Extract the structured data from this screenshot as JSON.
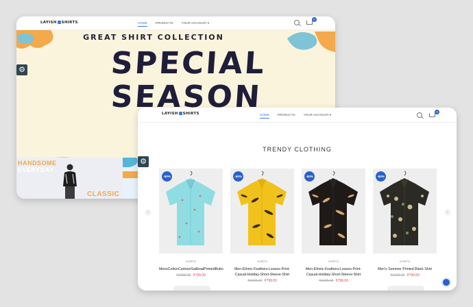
{
  "back_window": {
    "brand": {
      "left": "LAYISH",
      "right": "SHIRTS"
    },
    "menu": [
      "HOME",
      "PRODUCTS",
      "YOUR ACCOUNT ▾"
    ],
    "cart_count": "0",
    "hero": {
      "tagline": "GREAT SHIRT COLLECTION",
      "headline_1": "SPECIAL",
      "headline_2": "SEASON"
    },
    "banner": {
      "line1": "HANDSOME",
      "line2": "EVERYDAY",
      "line3": "CLASSIC"
    }
  },
  "front_window": {
    "brand": {
      "left": "LAYISH",
      "right": "SHIRTS"
    },
    "menu": [
      "HOME",
      "PRODUCTS",
      "YOUR ACCOUNT ▾"
    ],
    "cart_count": "0",
    "section_title": "TRENDY CLOTHING",
    "products": [
      {
        "discount": "-50%",
        "category": "SHIRTS",
        "name": "MensCottonCartoonSailboatPrintedButto",
        "old_price": "₹1599.00",
        "price": "₹799.00"
      },
      {
        "discount": "-50%",
        "category": "SHIRTS",
        "name": "Men-Ethnic-Feathers-Leaves-Print-Casual-Holiday-Short-Sleeve-Shirt",
        "old_price": "₹1599.00",
        "price": "₹799.00"
      },
      {
        "discount": "-50%",
        "category": "SHIRTS",
        "name": "Men-Ethnic-Feathers-Leaves-Print-Casual-Holiday-Short-Sleeve-Shirt",
        "old_price": "₹1599.00",
        "price": "₹799.00"
      },
      {
        "discount": "-50%",
        "category": "SHIRTS",
        "name": "Men's Summer Printed Black Shirt",
        "old_price": "₹1599.00",
        "price": "₹799.00"
      }
    ]
  },
  "colors": {
    "accent": "#2a62c9",
    "sale": "#e0453d",
    "hero_bg": "#fbf4dd",
    "hero_text": "#1f1e3a"
  }
}
